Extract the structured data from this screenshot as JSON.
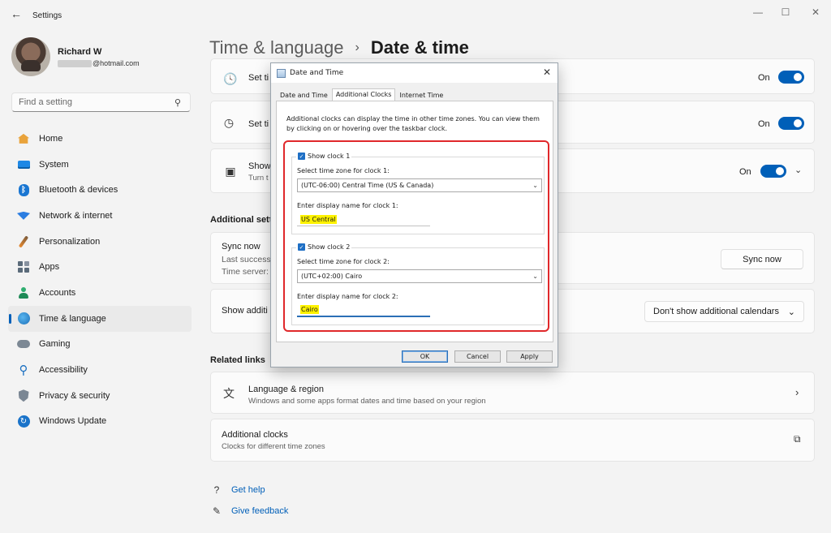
{
  "window": {
    "title": "Settings",
    "back": "←",
    "minimize": "—",
    "maximize": "☐",
    "close": "✕"
  },
  "user": {
    "name": "Richard W",
    "email_suffix": "@hotmail.com"
  },
  "search": {
    "placeholder": "Find a setting"
  },
  "sidebar": {
    "items": [
      {
        "label": "Home",
        "icon": "home-icon"
      },
      {
        "label": "System",
        "icon": "monitor-icon"
      },
      {
        "label": "Bluetooth & devices",
        "icon": "bluetooth-icon"
      },
      {
        "label": "Network & internet",
        "icon": "wifi-icon"
      },
      {
        "label": "Personalization",
        "icon": "brush-icon"
      },
      {
        "label": "Apps",
        "icon": "apps-icon"
      },
      {
        "label": "Accounts",
        "icon": "person-icon"
      },
      {
        "label": "Time & language",
        "icon": "globe-clock-icon",
        "active": true
      },
      {
        "label": "Gaming",
        "icon": "gamepad-icon"
      },
      {
        "label": "Accessibility",
        "icon": "accessibility-icon"
      },
      {
        "label": "Privacy & security",
        "icon": "shield-icon"
      },
      {
        "label": "Windows Update",
        "icon": "update-icon"
      }
    ]
  },
  "breadcrumb": {
    "parent": "Time & language",
    "separator": "›",
    "current": "Date & time"
  },
  "settings": {
    "row1": {
      "title": "Set ti",
      "toggle_label": "On"
    },
    "row2": {
      "title": "Set ti",
      "toggle_label": "On"
    },
    "row3": {
      "title": "Show",
      "subtitle": "Turn t",
      "toggle_label": "On"
    },
    "additional_heading": "Additional sett",
    "sync": {
      "title": "Sync now",
      "line1": "Last successf",
      "line2": "Time server:",
      "button": "Sync now"
    },
    "calendars": {
      "title": "Show additi",
      "value": "Don't show additional calendars"
    }
  },
  "related": {
    "heading": "Related links",
    "language_region": {
      "title": "Language & region",
      "subtitle": "Windows and some apps format dates and time based on your region"
    },
    "additional_clocks": {
      "title": "Additional clocks",
      "subtitle": "Clocks for different time zones"
    }
  },
  "help_links": {
    "get_help": "Get help",
    "give_feedback": "Give feedback"
  },
  "dialog": {
    "title": "Date and Time",
    "tabs": [
      "Date and Time",
      "Additional Clocks",
      "Internet Time"
    ],
    "active_tab": "Additional Clocks",
    "intro": "Additional clocks can display the time in other time zones. You can view them by clicking on or hovering over the taskbar clock.",
    "clock1": {
      "show_label": "Show clock 1",
      "checked": true,
      "tz_label": "Select time zone for clock 1:",
      "tz_value": "(UTC-06:00) Central Time (US & Canada)",
      "name_label": "Enter display name for clock 1:",
      "name_value": "US Central"
    },
    "clock2": {
      "show_label": "Show clock 2",
      "checked": true,
      "tz_label": "Select time zone for clock 2:",
      "tz_value": "(UTC+02:00) Cairo",
      "name_label": "Enter display name for clock 2:",
      "name_value": "Cairo"
    },
    "buttons": {
      "ok": "OK",
      "cancel": "Cancel",
      "apply": "Apply"
    }
  },
  "colors": {
    "accent": "#005fb8",
    "highlight": "#fff200",
    "annotation_red": "#e0282b"
  }
}
